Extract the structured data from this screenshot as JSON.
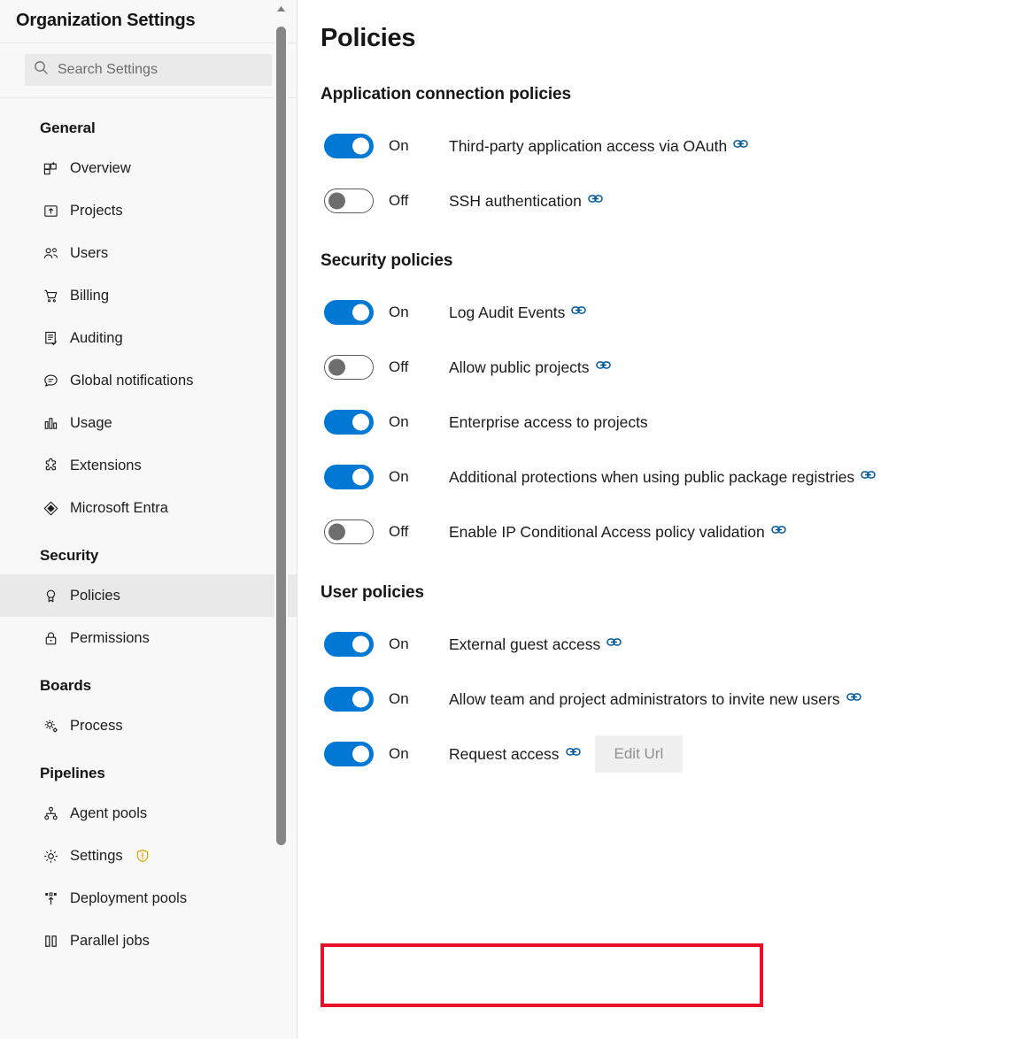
{
  "sidebar": {
    "title": "Organization Settings",
    "search": {
      "placeholder": "Search Settings",
      "value": "",
      "icon": "search-icon"
    },
    "groups": [
      {
        "heading": "General",
        "items": [
          {
            "label": "Overview",
            "icon": "overview-icon",
            "selected": false
          },
          {
            "label": "Projects",
            "icon": "projects-icon",
            "selected": false
          },
          {
            "label": "Users",
            "icon": "users-icon",
            "selected": false
          },
          {
            "label": "Billing",
            "icon": "cart-icon",
            "selected": false
          },
          {
            "label": "Auditing",
            "icon": "auditing-icon",
            "selected": false
          },
          {
            "label": "Global notifications",
            "icon": "comment-icon",
            "selected": false
          },
          {
            "label": "Usage",
            "icon": "bar-chart-icon",
            "selected": false
          },
          {
            "label": "Extensions",
            "icon": "puzzle-icon",
            "selected": false
          },
          {
            "label": "Microsoft Entra",
            "icon": "entra-icon",
            "selected": false
          }
        ]
      },
      {
        "heading": "Security",
        "items": [
          {
            "label": "Policies",
            "icon": "ribbon-icon",
            "selected": true
          },
          {
            "label": "Permissions",
            "icon": "lock-icon",
            "selected": false
          }
        ]
      },
      {
        "heading": "Boards",
        "items": [
          {
            "label": "Process",
            "icon": "process-gear-icon",
            "selected": false
          }
        ]
      },
      {
        "heading": "Pipelines",
        "items": [
          {
            "label": "Agent pools",
            "icon": "agent-pools-icon",
            "selected": false
          },
          {
            "label": "Settings",
            "icon": "gear-icon",
            "selected": false,
            "badge": "warning-shield-icon"
          },
          {
            "label": "Deployment pools",
            "icon": "deployment-pools-icon",
            "selected": false
          },
          {
            "label": "Parallel jobs",
            "icon": "parallel-jobs-icon",
            "selected": false
          }
        ]
      }
    ],
    "scrollbar": {
      "up_arrow": "scroll-up-arrow-icon"
    }
  },
  "main": {
    "page_title": "Policies",
    "sections": [
      {
        "heading": "Application connection policies",
        "rows": [
          {
            "state": "On",
            "on": true,
            "label": "Third-party application access via OAuth",
            "link": true
          },
          {
            "state": "Off",
            "on": false,
            "label": "SSH authentication",
            "link": true
          }
        ]
      },
      {
        "heading": "Security policies",
        "rows": [
          {
            "state": "On",
            "on": true,
            "label": "Log Audit Events",
            "link": true
          },
          {
            "state": "Off",
            "on": false,
            "label": "Allow public projects",
            "link": true
          },
          {
            "state": "On",
            "on": true,
            "label": "Enterprise access to projects",
            "link": false
          },
          {
            "state": "On",
            "on": true,
            "label": "Additional protections when using public package registries",
            "link": true
          },
          {
            "state": "Off",
            "on": false,
            "label": "Enable IP Conditional Access policy validation",
            "link": true
          }
        ]
      },
      {
        "heading": "User policies",
        "rows": [
          {
            "state": "On",
            "on": true,
            "label": "External guest access",
            "link": true
          },
          {
            "state": "On",
            "on": true,
            "label": "Allow team and project administrators to invite new users",
            "link": true
          },
          {
            "state": "On",
            "on": true,
            "label": "Request access",
            "link": true,
            "button": "Edit Url",
            "highlighted": true
          }
        ]
      }
    ]
  },
  "annotation": {
    "highlight_color": "#e8102a",
    "target": "Request access"
  },
  "colors": {
    "toggle_on": "#0078d4",
    "toggle_off_border": "#5a5a5a",
    "link_icon": "#005a9e",
    "sidebar_bg": "#f8f8f8",
    "selected_bg": "#e9e9e9",
    "warning_badge": "#d9a400",
    "highlight": "#e8102a"
  }
}
